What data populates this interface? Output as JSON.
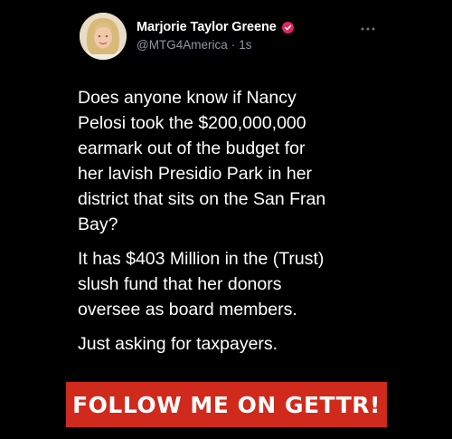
{
  "author": {
    "display_name": "Marjorie Taylor Greene",
    "handle": "@MTG4America",
    "separator": "·",
    "time_ago": "1s",
    "verified_badge_icon": "red-check-badge-icon"
  },
  "menu": {
    "icon": "more-horizontal-icon"
  },
  "tweet": {
    "paragraph_1_lines": [
      "Does anyone know if Nancy",
      "Pelosi took the $200,000,000",
      "earmark out of the budget for",
      "her lavish Presidio Park in her",
      "district that sits on the San Fran",
      "Bay?"
    ],
    "paragraph_2_lines": [
      "It has $403 Million in the (Trust)",
      "slush fund that her donors",
      "oversee as board members."
    ],
    "paragraph_3_lines": [
      "Just asking for taxpayers."
    ]
  },
  "banner": {
    "label": "FOLLOW ME ON GETTR!",
    "color": "#cf2a1c"
  },
  "colors": {
    "background": "#000000",
    "text_primary": "#ffffff",
    "text_secondary": "#8b98a5",
    "badge": "#e0245e"
  }
}
